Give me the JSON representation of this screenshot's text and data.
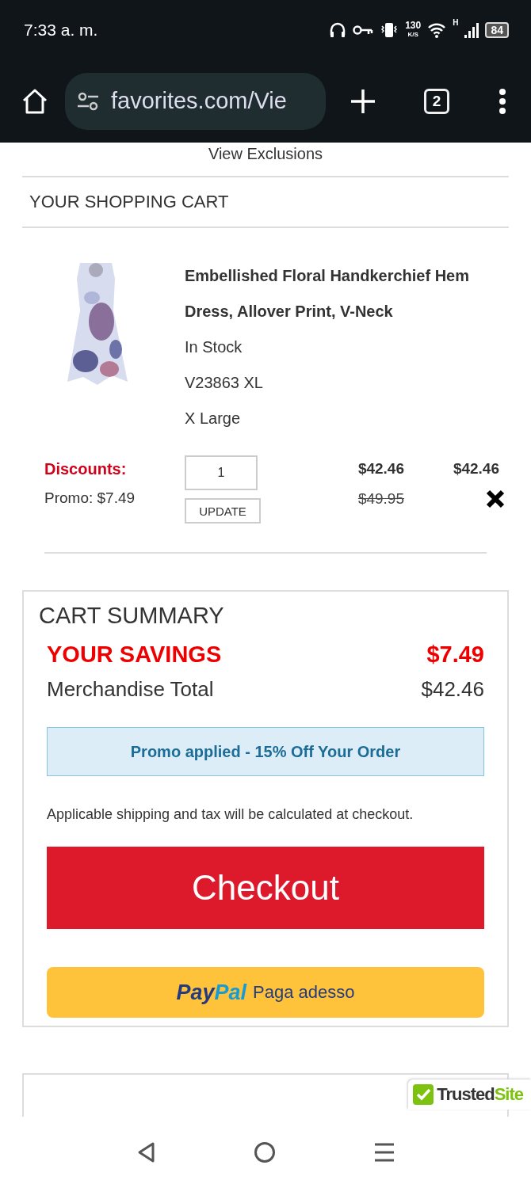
{
  "status_bar": {
    "time": "7:33 a. m.",
    "speed_value": "130",
    "speed_unit": "K/S",
    "network": "H",
    "battery": "84"
  },
  "browser": {
    "url": "favorites.com/Vie",
    "tab_count": "2"
  },
  "exclusions_link": "View Exclusions",
  "cart": {
    "title": "YOUR SHOPPING CART",
    "item": {
      "name": "Embellished Floral Handkerchief Hem Dress, Allover Print, V-Neck",
      "stock": "In Stock",
      "sku": "V23863 XL",
      "size": "X Large",
      "discounts_label": "Discounts:",
      "promo": "Promo: $7.49",
      "quantity": "1",
      "update_button": "UPDATE",
      "price": "$42.46",
      "original_price": "$49.95",
      "total": "$42.46"
    }
  },
  "summary": {
    "title": "CART SUMMARY",
    "savings_label": "YOUR SAVINGS",
    "savings_value": "$7.49",
    "merch_label": "Merchandise Total",
    "merch_value": "$42.46",
    "promo_banner": "Promo applied - 15% Off Your Order",
    "note": "Applicable shipping and tax will be calculated at checkout.",
    "checkout_button": "Checkout",
    "paypal_logo_1": "Pay",
    "paypal_logo_2": "Pal",
    "paypal_text": "Paga adesso"
  },
  "trusted_badge": {
    "part_1": "Trusted",
    "part_2": "Site"
  }
}
